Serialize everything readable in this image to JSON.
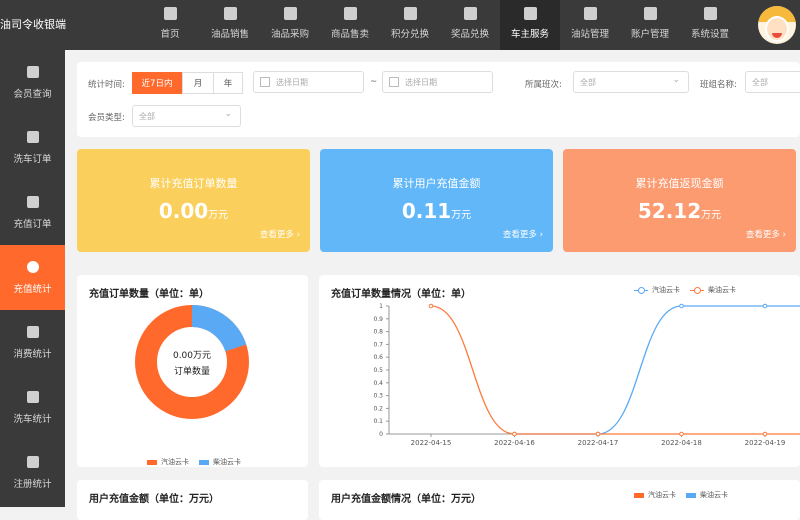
{
  "app": {
    "logo_alt": "油司令收银端"
  },
  "nav": {
    "items": [
      {
        "label": "首页",
        "icon": "home-icon"
      },
      {
        "label": "油品销售",
        "icon": "fuel-sale-icon"
      },
      {
        "label": "油品采购",
        "icon": "purchase-icon"
      },
      {
        "label": "商品售卖",
        "icon": "shop-bag-icon"
      },
      {
        "label": "积分兑换",
        "icon": "coins-icon"
      },
      {
        "label": "奖品兑换",
        "icon": "gift-icon"
      },
      {
        "label": "车主服务",
        "icon": "car-icon",
        "active": true
      },
      {
        "label": "油站管理",
        "icon": "gas-station-icon"
      },
      {
        "label": "账户管理",
        "icon": "account-icon"
      },
      {
        "label": "系统设置",
        "icon": "gear-icon"
      }
    ]
  },
  "sidebar": {
    "items": [
      {
        "label": "会员查询",
        "icon": "member-search-icon"
      },
      {
        "label": "洗车订单",
        "icon": "order-list-icon"
      },
      {
        "label": "充值订单",
        "icon": "yuan-icon"
      },
      {
        "label": "充值统计",
        "icon": "pie-icon",
        "active": true
      },
      {
        "label": "消费统计",
        "icon": "car-icon"
      },
      {
        "label": "洗车统计",
        "icon": "car-wash-icon"
      },
      {
        "label": "注册统计",
        "icon": "user-add-icon"
      }
    ]
  },
  "filters": {
    "time_label": "统计时间:",
    "time_options": [
      "近7日内",
      "月",
      "年"
    ],
    "start_placeholder": "选择日期",
    "range_sep": "~",
    "end_placeholder": "选择日期",
    "shift_label": "所属班次:",
    "shift_value": "全部",
    "team_label": "班组名称:",
    "team_value": "全部",
    "member_type_label": "会员类型:",
    "member_type_value": "全部"
  },
  "cards": [
    {
      "title": "累计充值订单数量",
      "value": "0.00",
      "unit": "万元",
      "more": "查看更多",
      "color": "#fbcf5b"
    },
    {
      "title": "累计用户充值金额",
      "value": "0.11",
      "unit": "万元",
      "more": "查看更多",
      "color": "#62b7f9"
    },
    {
      "title": "累计充值返现金额",
      "value": "52.12",
      "unit": "万元",
      "more": "查看更多",
      "color": "#fc9a70"
    }
  ],
  "donut": {
    "title": "充值订单数量（单位：单）",
    "center_value": "0.00万元",
    "center_label": "订单数量",
    "legend": [
      {
        "name": "汽油云卡",
        "color": "#ff6a2c"
      },
      {
        "name": "柴油云卡",
        "color": "#5aa9f5"
      }
    ],
    "share_blue": 0.2
  },
  "line_panel": {
    "title": "充值订单数量情况（单位：单）",
    "legend": [
      {
        "name": "汽油云卡",
        "color": "#5aa9f5"
      },
      {
        "name": "柴油云卡",
        "color": "#ff7a3d"
      }
    ]
  },
  "chart_data": {
    "type": "line",
    "x": [
      "2022-04-15",
      "2022-04-16",
      "2022-04-17",
      "2022-04-18",
      "2022-04-19"
    ],
    "yticks": [
      "0",
      "0.1",
      "0.2",
      "0.3",
      "0.4",
      "0.5",
      "0.6",
      "0.7",
      "0.8",
      "0.9",
      "1"
    ],
    "ylim": [
      0,
      1
    ],
    "series": [
      {
        "name": "汽油云卡",
        "color": "#5aa9f5",
        "values": [
          null,
          0,
          0,
          1,
          1
        ]
      },
      {
        "name": "柴油云卡",
        "color": "#ff7a3d",
        "values": [
          1,
          0,
          0,
          0,
          0
        ]
      }
    ]
  },
  "bottom": {
    "left_title": "用户充值金额（单位：万元）",
    "right_title": "用户充值金额情况（单位：万元）",
    "legend": [
      {
        "name": "汽油云卡",
        "color": "#ff6a2c"
      },
      {
        "name": "柴油云卡",
        "color": "#5aa9f5"
      }
    ]
  }
}
